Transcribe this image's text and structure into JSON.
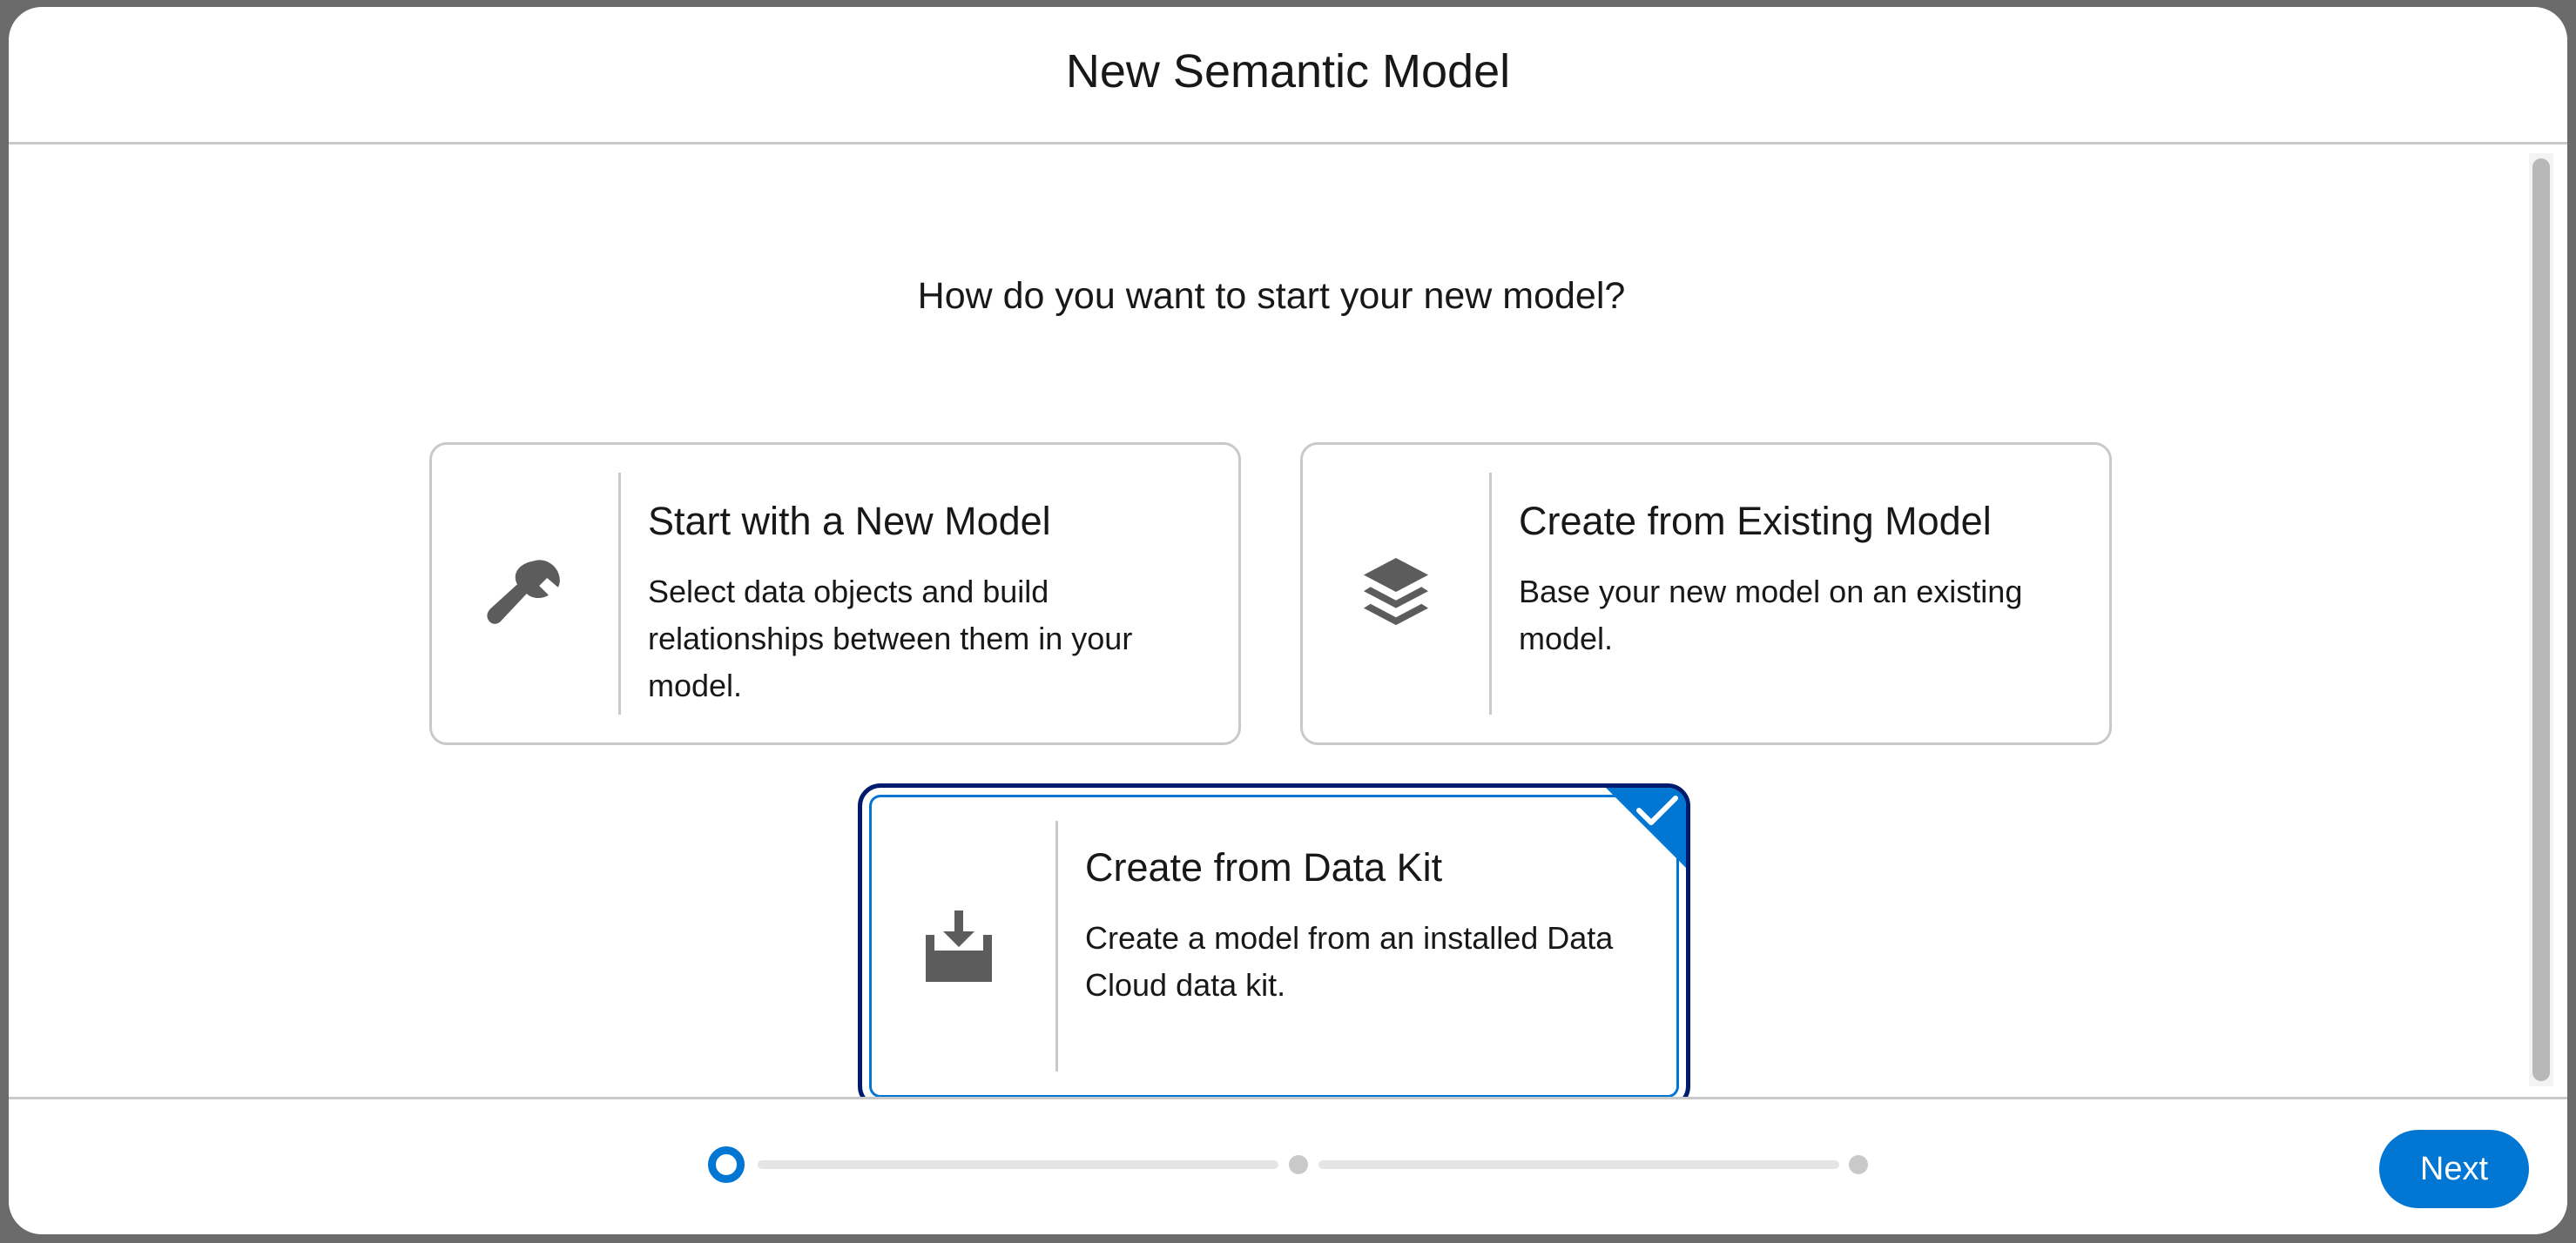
{
  "modal": {
    "title": "New Semantic Model"
  },
  "body": {
    "question": "How do you want to start your new model?",
    "options": [
      {
        "title": "Start with a New Model",
        "description": "Select data objects and build relationships between them in your model.",
        "icon": "wrench-icon",
        "selected": false
      },
      {
        "title": "Create from Existing Model",
        "description": "Base your new model on an existing model.",
        "icon": "layers-icon",
        "selected": false
      },
      {
        "title": "Create from Data Kit",
        "description": "Create a model from an installed Data Cloud data kit.",
        "icon": "download-tray-icon",
        "selected": true
      }
    ]
  },
  "footer": {
    "progress": {
      "current_step": 1,
      "total_steps": 3
    },
    "next_label": "Next"
  },
  "colors": {
    "accent": "#0176d3",
    "selected_border": "#001a6e",
    "card_border": "#c9c9c9",
    "icon": "#5c5c5c"
  }
}
